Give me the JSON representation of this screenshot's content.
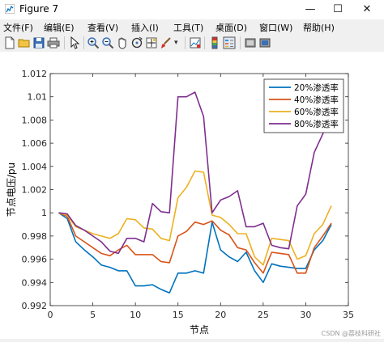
{
  "window": {
    "title": "Figure 7",
    "minimize": "—",
    "maximize": "☐",
    "close": "✕"
  },
  "menu": {
    "items": [
      "文件(F)",
      "编辑(E)",
      "查看(V)",
      "插入(I)",
      "工具(T)",
      "桌面(D)",
      "窗口(W)",
      "帮助(H)"
    ]
  },
  "toolbar": {
    "icons": [
      "new-figure-icon",
      "open-file-icon",
      "save-icon",
      "print-icon",
      "pointer-icon",
      "zoom-in-icon",
      "zoom-out-icon",
      "pan-icon",
      "rotate-3d-icon",
      "data-cursor-icon",
      "brush-icon",
      "link-plot-icon",
      "colorbar-icon",
      "legend-icon",
      "hide-plot-tools-icon",
      "show-plot-tools-icon"
    ]
  },
  "watermark": "CSDN @荔枝科研社",
  "colors": {
    "s20": "#0072BD",
    "s40": "#D95319",
    "s60": "#EDB120",
    "s80": "#7E2F8E"
  },
  "chart_data": {
    "type": "line",
    "xlabel": "节点",
    "ylabel": "节点电压/pu",
    "xlim": [
      0,
      35
    ],
    "ylim": [
      0.992,
      1.012
    ],
    "xticks": [
      0,
      5,
      10,
      15,
      20,
      25,
      30,
      35
    ],
    "yticks": [
      0.992,
      0.994,
      0.996,
      0.998,
      1,
      1.002,
      1.004,
      1.006,
      1.008,
      1.01,
      1.012
    ],
    "ytick_labels": [
      "0.992",
      "0.994",
      "0.996",
      "0.998",
      "1",
      "1.002",
      "1.004",
      "1.006",
      "1.008",
      "1.01",
      "1.012"
    ],
    "grid": false,
    "legend_position": "top-right",
    "x": [
      1,
      2,
      3,
      4,
      5,
      6,
      7,
      8,
      9,
      10,
      11,
      12,
      13,
      14,
      15,
      16,
      17,
      18,
      19,
      20,
      21,
      22,
      23,
      24,
      25,
      26,
      27,
      28,
      29,
      30,
      31,
      32,
      33
    ],
    "series": [
      {
        "name": "20%渗透率",
        "color": "#0072BD",
        "values": [
          1.0,
          0.9995,
          0.9975,
          0.9968,
          0.9962,
          0.9955,
          0.9953,
          0.995,
          0.995,
          0.9937,
          0.9937,
          0.9938,
          0.9934,
          0.9931,
          0.9948,
          0.9948,
          0.995,
          0.9948,
          0.9992,
          0.9968,
          0.9962,
          0.9958,
          0.9966,
          0.995,
          0.994,
          0.9956,
          0.9954,
          0.9953,
          0.9952,
          0.9952,
          0.9968,
          0.9976,
          0.999
        ]
      },
      {
        "name": "40%渗透率",
        "color": "#D95319",
        "values": [
          1.0,
          0.9997,
          0.998,
          0.9975,
          0.997,
          0.9965,
          0.9963,
          0.9968,
          0.9972,
          0.9964,
          0.9964,
          0.9964,
          0.9958,
          0.9957,
          0.998,
          0.9984,
          0.9992,
          0.999,
          0.9993,
          0.9985,
          0.9981,
          0.997,
          0.9968,
          0.9957,
          0.9948,
          0.9966,
          0.9965,
          0.9964,
          0.9948,
          0.9948,
          0.997,
          0.998,
          0.9991
        ]
      },
      {
        "name": "60%渗透率",
        "color": "#EDB120",
        "values": [
          1.0,
          0.9998,
          0.9988,
          0.9985,
          0.9982,
          0.998,
          0.9978,
          0.9982,
          0.9995,
          0.9994,
          0.9987,
          0.9986,
          0.9978,
          0.9976,
          1.0013,
          1.0022,
          1.0036,
          1.0035,
          0.9998,
          0.9996,
          0.999,
          0.9982,
          0.9982,
          0.9962,
          0.9955,
          0.9978,
          0.9977,
          0.9976,
          0.996,
          0.9963,
          0.9982,
          0.999,
          1.0006
        ]
      },
      {
        "name": "80%渗透率",
        "color": "#7E2F8E",
        "values": [
          1.0,
          0.9999,
          0.9989,
          0.9985,
          0.998,
          0.9975,
          0.9967,
          0.9965,
          0.9978,
          0.9978,
          0.9975,
          1.0008,
          1.0001,
          1.0,
          1.01,
          1.01,
          1.0104,
          1.0083,
          1.0,
          1.0011,
          1.0014,
          1.0019,
          0.9988,
          0.9988,
          0.9991,
          0.9972,
          0.997,
          0.9969,
          1.0006,
          1.0016,
          1.0052,
          1.0068,
          1.0087
        ]
      }
    ]
  }
}
